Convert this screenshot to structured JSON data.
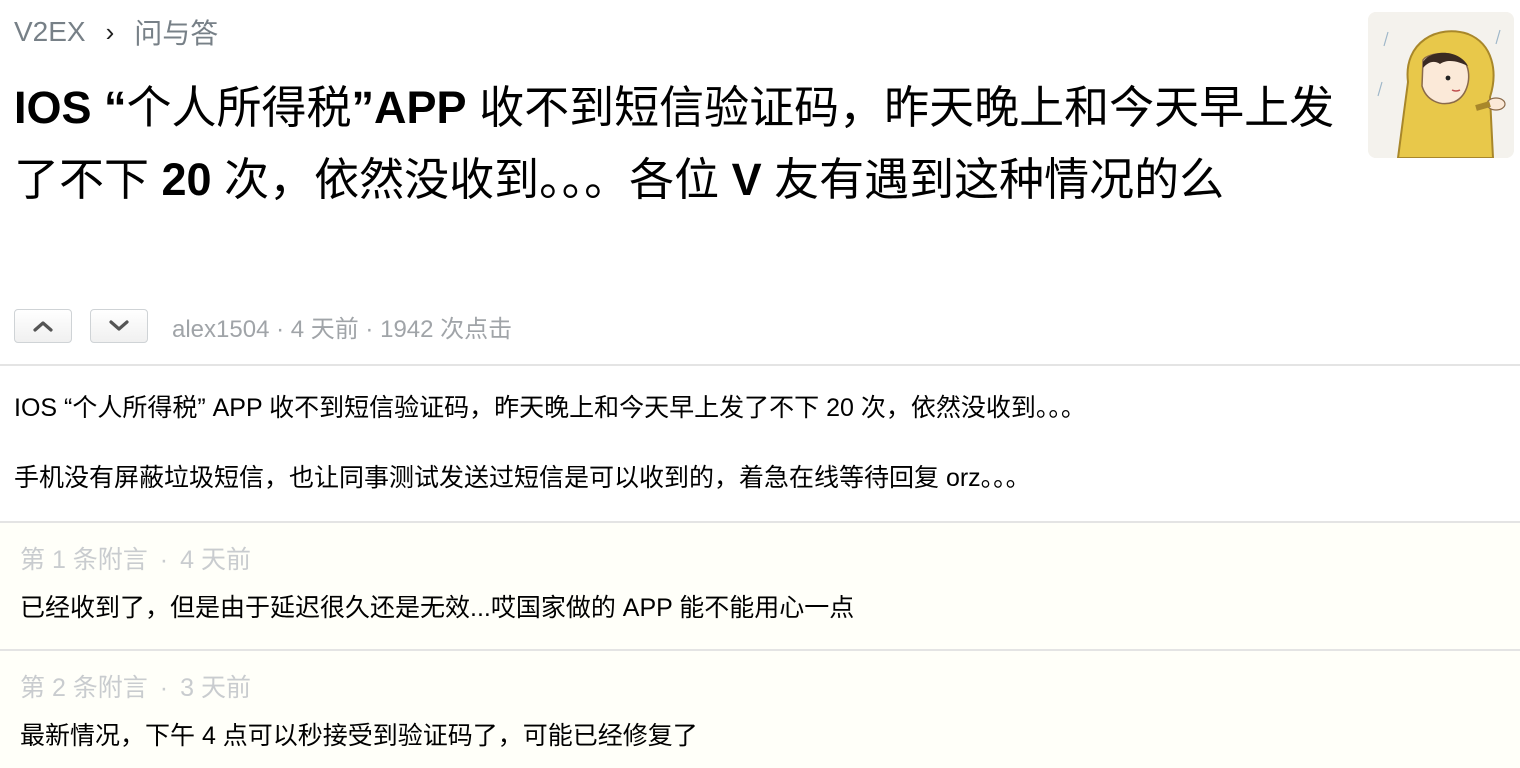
{
  "breadcrumb": {
    "site": "V2EX",
    "separator": "›",
    "node": "问与答"
  },
  "title": {
    "part1": "IOS “",
    "part2": "个人所得税",
    "part3": "”APP",
    "part4": " 收不到短信验证码，昨天晚上和今天早上发了不下 ",
    "part5": "20",
    "part6": " 次，依然没收到。。。各位 ",
    "part7": "V",
    "part8": " 友有遇到这种情况的么"
  },
  "meta": {
    "author": "alex1504",
    "separator1": " · ",
    "time": "4 天前",
    "separator2": " · ",
    "clicks": "1942 次点击"
  },
  "content": {
    "paragraphs": [
      "IOS “个人所得税” APP 收不到短信验证码，昨天晚上和今天早上发了不下 20 次，依然没收到。。。",
      "手机没有屏蔽垃圾短信，也让同事测试发送过短信是可以收到的，着急在线等待回复 orz。。。"
    ]
  },
  "appendices": [
    {
      "label": "第 1 条附言",
      "separator": "·",
      "time": "4 天前",
      "text": "已经收到了，但是由于延迟很久还是无效...哎国家做的 APP 能不能用心一点"
    },
    {
      "label": "第 2 条附言",
      "separator": "·",
      "time": "3 天前",
      "text": "最新情况，下午 4 点可以秒接受到验证码了，可能已经修复了"
    }
  ],
  "icons": {
    "upvote": "chevron-up-icon",
    "downvote": "chevron-down-icon"
  },
  "colors": {
    "meta_gray": "#a0a4a8",
    "breadcrumb_gray": "#778087",
    "appendix_bg": "#fffff9",
    "appendix_label": "#c9cccf",
    "avatar_coat": "#e8c84a"
  }
}
